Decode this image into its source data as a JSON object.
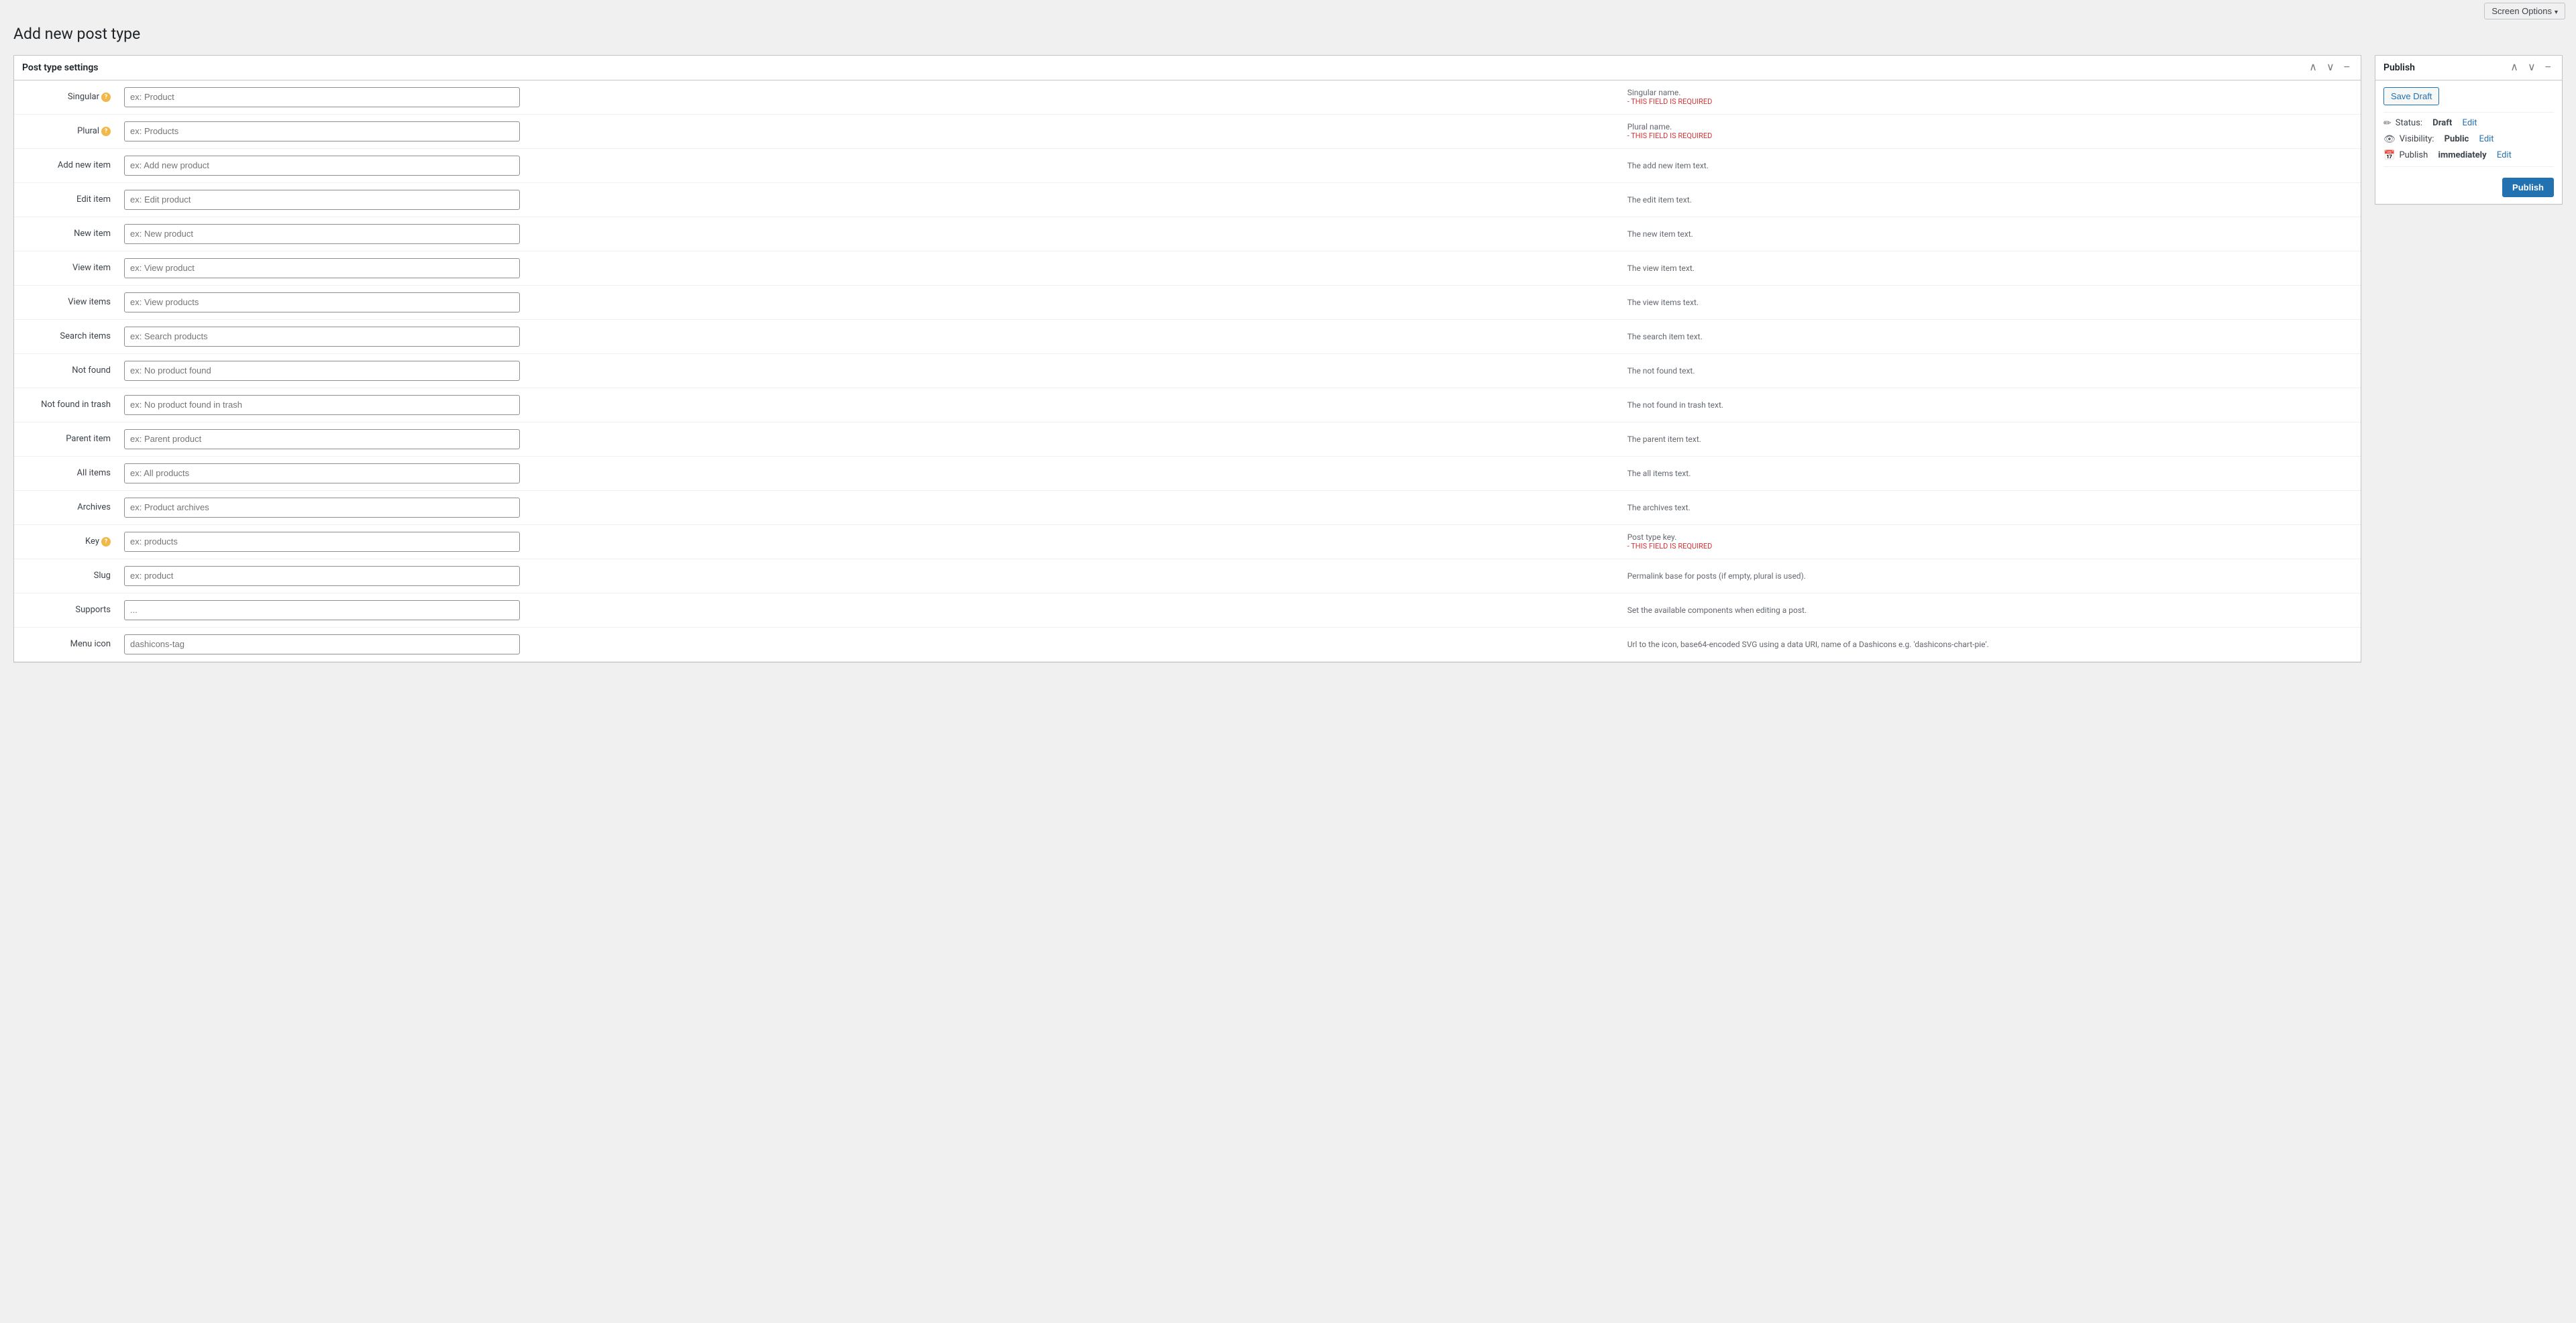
{
  "topbar": {
    "screen_options_label": "Screen Options"
  },
  "page": {
    "title": "Add new post type"
  },
  "panel": {
    "title": "Post type settings",
    "fields": [
      {
        "label": "Singular",
        "has_info": true,
        "placeholder": "ex: Product",
        "hint": "Singular name.",
        "required": true,
        "required_text": "- THIS FIELD IS REQUIRED"
      },
      {
        "label": "Plural",
        "has_info": true,
        "placeholder": "ex: Products",
        "hint": "Plural name.",
        "required": true,
        "required_text": "- THIS FIELD IS REQUIRED"
      },
      {
        "label": "Add new item",
        "has_info": false,
        "placeholder": "ex: Add new product",
        "hint": "The add new item text.",
        "required": false,
        "required_text": ""
      },
      {
        "label": "Edit item",
        "has_info": false,
        "placeholder": "ex: Edit product",
        "hint": "The edit item text.",
        "required": false,
        "required_text": ""
      },
      {
        "label": "New item",
        "has_info": false,
        "placeholder": "ex: New product",
        "hint": "The new item text.",
        "required": false,
        "required_text": ""
      },
      {
        "label": "View item",
        "has_info": false,
        "placeholder": "ex: View product",
        "hint": "The view item text.",
        "required": false,
        "required_text": ""
      },
      {
        "label": "View items",
        "has_info": false,
        "placeholder": "ex: View products",
        "hint": "The view items text.",
        "required": false,
        "required_text": ""
      },
      {
        "label": "Search items",
        "has_info": false,
        "placeholder": "ex: Search products",
        "hint": "The search item text.",
        "required": false,
        "required_text": ""
      },
      {
        "label": "Not found",
        "has_info": false,
        "placeholder": "ex: No product found",
        "hint": "The not found text.",
        "required": false,
        "required_text": ""
      },
      {
        "label": "Not found in trash",
        "has_info": false,
        "placeholder": "ex: No product found in trash",
        "hint": "The not found in trash text.",
        "required": false,
        "required_text": ""
      },
      {
        "label": "Parent item",
        "has_info": false,
        "placeholder": "ex: Parent product",
        "hint": "The parent item text.",
        "required": false,
        "required_text": ""
      },
      {
        "label": "All items",
        "has_info": false,
        "placeholder": "ex: All products",
        "hint": "The all items text.",
        "required": false,
        "required_text": ""
      },
      {
        "label": "Archives",
        "has_info": false,
        "placeholder": "ex: Product archives",
        "hint": "The archives text.",
        "required": false,
        "required_text": ""
      },
      {
        "label": "Key",
        "has_info": true,
        "placeholder": "ex: products",
        "hint": "Post type key.",
        "required": true,
        "required_text": "- THIS FIELD IS REQUIRED"
      },
      {
        "label": "Slug",
        "has_info": false,
        "placeholder": "ex: product",
        "hint": "Permalink base for posts (if empty, plural is used).",
        "required": false,
        "required_text": ""
      },
      {
        "label": "Supports",
        "has_info": false,
        "placeholder": "...",
        "hint": "Set the available components when editing a post.",
        "required": false,
        "required_text": ""
      },
      {
        "label": "Menu icon",
        "has_info": false,
        "placeholder": "dashicons-tag",
        "hint": "Url to the icon, base64-encoded SVG using a data URI, name of a Dashicons e.g. 'dashicons-chart-pie'.",
        "required": false,
        "required_text": ""
      }
    ]
  },
  "publish": {
    "title": "Publish",
    "save_draft_label": "Save Draft",
    "status_label": "Status:",
    "status_value": "Draft",
    "status_edit": "Edit",
    "visibility_label": "Visibility:",
    "visibility_value": "Public",
    "visibility_edit": "Edit",
    "publish_label": "Publish",
    "publish_when": "immediately",
    "publish_edit": "Edit",
    "publish_button": "Publish"
  }
}
